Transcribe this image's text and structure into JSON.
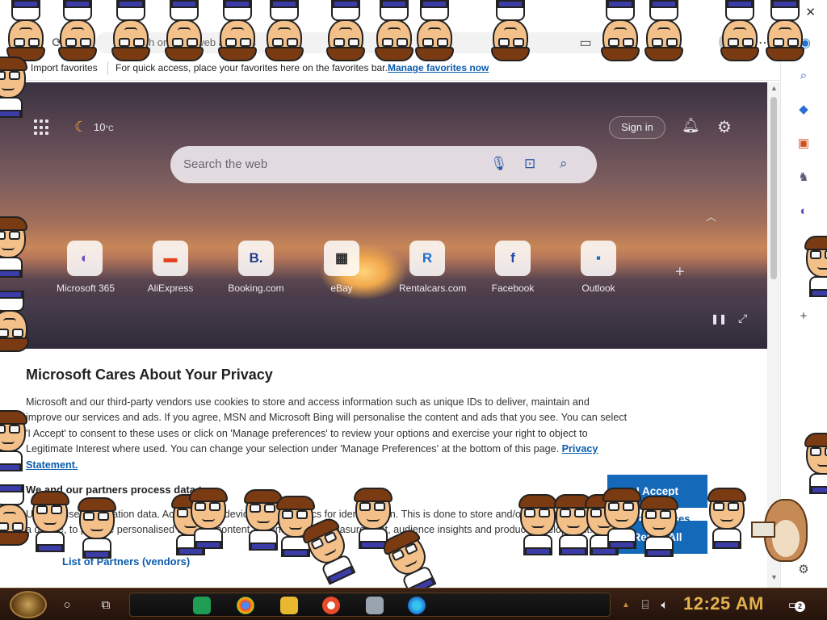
{
  "browser": {
    "close_label": "✕",
    "address_placeholder": "Search or enter web address"
  },
  "favorites_bar": {
    "import_label": "Import favorites",
    "hint_text": "For quick access, place your favorites here on the favorites bar.",
    "manage_link": "Manage favorites now"
  },
  "new_tab": {
    "weather_temp": "10",
    "weather_unit": "°C",
    "signin_label": "Sign in",
    "search_placeholder": "Search the web",
    "tiles": [
      {
        "label": "Microsoft 365",
        "glyph": "◐",
        "color": "#6b4fc8"
      },
      {
        "label": "AliExpress",
        "glyph": "▬",
        "color": "#e2431e"
      },
      {
        "label": "Booking.com",
        "glyph": "B.",
        "color": "#1f3d8f"
      },
      {
        "label": "eBay",
        "glyph": "▦",
        "color": "#2b2b2b"
      },
      {
        "label": "Rentalcars.com",
        "glyph": "R",
        "color": "#1b6fd1"
      },
      {
        "label": "Facebook",
        "glyph": "f",
        "color": "#1e4fa8"
      },
      {
        "label": "Outlook",
        "glyph": "▪",
        "color": "#1c6cc7"
      }
    ]
  },
  "privacy": {
    "title": "Microsoft Cares About Your Privacy",
    "body": "Microsoft and our third-party vendors use cookies to store and access information such as unique IDs to deliver, maintain and improve our services and ads. If you agree, MSN and Microsoft Bing will personalise the content and ads that you see. You can select 'I Accept' to consent to these uses or click on 'Manage preferences' to review your options and exercise your right to object to Legitimate Interest where used.  You can change your selection under 'Manage Preferences' at the bottom of this page.",
    "privacy_link": "Privacy Statement.",
    "subheading": "We and our partners process data to:",
    "purposes": "Use precise geolocation data. Actively scan device characteristics for identification. This is done to store and/or access information on a device, to provide personalised ads and content, ad and content measurement, audience insights and product development.",
    "list_partners": "List of Partners (vendors)",
    "manage_preferences": "Manage Preferences",
    "accept_label": "I Accept",
    "reject_label": "Reject All"
  },
  "taskbar": {
    "clock": "12:25 AM",
    "notification_count": "2",
    "pinned_apps": [
      "sheets-icon",
      "chrome-icon",
      "file-explorer-icon",
      "browser-icon",
      "device-icon",
      "edge-icon"
    ]
  },
  "colors": {
    "accent": "#1469b8",
    "link": "#0b5cad",
    "clock": "#e3b24c"
  }
}
